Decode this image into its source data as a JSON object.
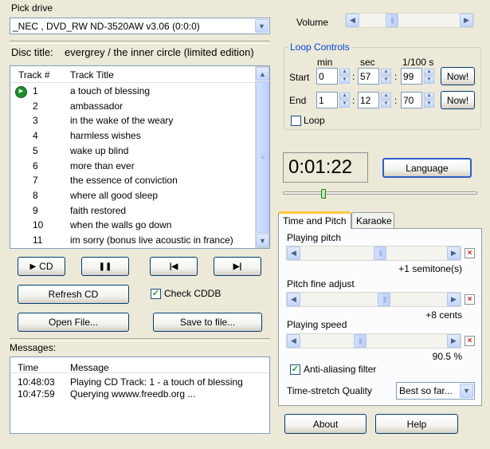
{
  "drive": {
    "label": "Pick drive",
    "selected": "_NEC    , DVD_RW ND-3520AW v3.06 (0:0:0)"
  },
  "disc": {
    "label": "Disc title:",
    "title": "evergrey / the inner circle (limited edition)"
  },
  "tracklist": {
    "col_track": "Track #",
    "col_title": "Track Title",
    "tracks": [
      {
        "num": "1",
        "title": "a touch of blessing"
      },
      {
        "num": "2",
        "title": "ambassador"
      },
      {
        "num": "3",
        "title": "in the wake of the weary"
      },
      {
        "num": "4",
        "title": "harmless wishes"
      },
      {
        "num": "5",
        "title": "wake up blind"
      },
      {
        "num": "6",
        "title": "more than ever"
      },
      {
        "num": "7",
        "title": "the essence of conviction"
      },
      {
        "num": "8",
        "title": "where all good sleep"
      },
      {
        "num": "9",
        "title": "faith restored"
      },
      {
        "num": "10",
        "title": "when the walls go down"
      },
      {
        "num": "11",
        "title": "im sorry (bonus live acoustic in france)"
      }
    ]
  },
  "transport": {
    "play_label": "CD",
    "play_glyph": "▶",
    "pause_glyph": "❚❚",
    "prev_glyph": "|◀",
    "next_glyph": "▶|"
  },
  "actions": {
    "refresh": "Refresh CD",
    "check_cddb": "Check CDDB",
    "open_file": "Open File...",
    "save_file": "Save to file..."
  },
  "messages": {
    "label": "Messages:",
    "col_time": "Time",
    "col_message": "Message",
    "rows": [
      {
        "time": "10:48:03",
        "message": "Playing CD Track: 1 - a touch of blessing"
      },
      {
        "time": "10:47:59",
        "message": "Querying wwww.freedb.org ..."
      }
    ]
  },
  "volume": {
    "label": "Volume",
    "level": 0.3
  },
  "loop": {
    "title": "Loop Controls",
    "col_min": "min",
    "col_sec": "sec",
    "col_hundredths": "1/100 s",
    "start_label": "Start",
    "end_label": "End",
    "start_min": "0",
    "start_sec": "57",
    "start_hund": "99",
    "end_min": "1",
    "end_sec": "12",
    "end_hund": "70",
    "now_label": "Now!",
    "loop_label": "Loop"
  },
  "time_display": "0:01:22",
  "language_label": "Language",
  "position_level": 0.2,
  "tabs": {
    "time_pitch": "Time and Pitch",
    "karaoke": "Karaoke"
  },
  "pitch": {
    "label": "Playing pitch",
    "value": "+1 semitone(s)",
    "level": 0.55
  },
  "fine": {
    "label": "Pitch fine adjust",
    "value": "+8 cents",
    "level": 0.58
  },
  "speed": {
    "label": "Playing speed",
    "value": "90.5 %",
    "level": 0.4
  },
  "antialias": {
    "label": "Anti-aliasing filter"
  },
  "stretch": {
    "label": "Time-stretch Quality",
    "value": "Best so far..."
  },
  "footer": {
    "about": "About",
    "help": "Help"
  }
}
